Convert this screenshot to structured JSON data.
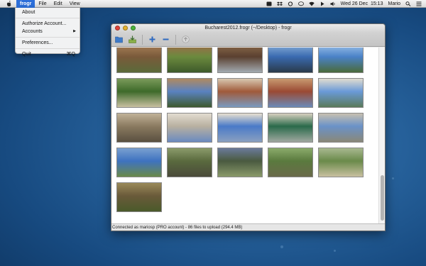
{
  "menubar": {
    "app_menu": "frogr",
    "menus": [
      "File",
      "Edit",
      "View"
    ],
    "clock": "Wed 26 Dec  15:13",
    "user": "Mario",
    "status_icons": [
      "frogr-status-icon",
      "dropbox-icon",
      "sync-icon",
      "chat-bubble-icon",
      "wifi-icon",
      "play-icon",
      "volume-icon",
      "spotlight-icon",
      "notification-list-icon"
    ]
  },
  "app_menu_items": {
    "about": "About",
    "authorize": "Authorize Account...",
    "accounts": "Accounts",
    "preferences": "Preferences...",
    "quit": "Quit",
    "quit_shortcut": "⌘Q"
  },
  "window": {
    "title": "Bucharest2012.frogr (~/Desktop) - frogr",
    "toolbar_icons": [
      "open-project-icon",
      "save-project-icon",
      "add-picture-icon",
      "remove-picture-icon",
      "upload-icon"
    ],
    "status_text": "Connected as mariosp (PRO account) - 86 files to upload (294.4 MB)"
  },
  "thumbnails": [
    {
      "name": "photo-wooden-house",
      "colors": [
        "#7a5a3a",
        "#a88058",
        "#5a6a3a"
      ]
    },
    {
      "name": "photo-garden-pavilion",
      "colors": [
        "#6b8a3e",
        "#a06a4a",
        "#3e5a2a"
      ]
    },
    {
      "name": "photo-church-porch",
      "colors": [
        "#5a4030",
        "#8a6a4a",
        "#a2aab0"
      ]
    },
    {
      "name": "photo-lake-skyline",
      "colors": [
        "#3a6ab0",
        "#8ab0d8",
        "#2a3a4a"
      ]
    },
    {
      "name": "photo-statue-bust",
      "colors": [
        "#4a82c8",
        "#9ec2e8",
        "#4a6a3a"
      ]
    },
    {
      "name": "photo-park-fountain",
      "colors": [
        "#3e6a2a",
        "#7a9a5a",
        "#c8c0a0"
      ]
    },
    {
      "name": "photo-monastery",
      "colors": [
        "#5a82c0",
        "#b08a60",
        "#3e5a2e"
      ]
    },
    {
      "name": "photo-red-brick-building",
      "colors": [
        "#a05a3a",
        "#d8c8b0",
        "#7a9ac0"
      ]
    },
    {
      "name": "photo-ornate-facade",
      "colors": [
        "#9a4a34",
        "#c89a70",
        "#6a8ab8"
      ]
    },
    {
      "name": "photo-palace-reflection",
      "colors": [
        "#6a9ad8",
        "#e0dcd0",
        "#5a7a5a"
      ]
    },
    {
      "name": "photo-stone-arcade",
      "colors": [
        "#8a7a60",
        "#c0b298",
        "#5a5040"
      ]
    },
    {
      "name": "photo-columned-hall",
      "colors": [
        "#b8b0a0",
        "#e2dcd0",
        "#6a8ac0"
      ]
    },
    {
      "name": "photo-grand-hotel",
      "colors": [
        "#4a7ac8",
        "#e8e0d0",
        "#8aa0c0"
      ]
    },
    {
      "name": "photo-green-sign",
      "colors": [
        "#2a6a4a",
        "#d8d0c0",
        "#a0a8a0"
      ]
    },
    {
      "name": "photo-parliament-palace",
      "colors": [
        "#6a92c8",
        "#c8c0b0",
        "#8a8878"
      ]
    },
    {
      "name": "photo-blue-office-block",
      "colors": [
        "#3e72c0",
        "#7aa0d0",
        "#6a8a4a"
      ]
    },
    {
      "name": "photo-old-car-yard",
      "colors": [
        "#5a6a3e",
        "#8a9a6a",
        "#4a4a3a"
      ]
    },
    {
      "name": "photo-blue-car",
      "colors": [
        "#4a5a40",
        "#6a7a9a",
        "#8a9a6a"
      ]
    },
    {
      "name": "photo-green-car",
      "colors": [
        "#5a7a3e",
        "#8aaa6a",
        "#6a6a4a"
      ]
    },
    {
      "name": "photo-tree-lined-road",
      "colors": [
        "#6a8a4a",
        "#a8b890",
        "#c8c0a0"
      ]
    },
    {
      "name": "photo-railway-tracks",
      "colors": [
        "#6a5a3a",
        "#9a8a5a",
        "#4a5a2a"
      ]
    }
  ]
}
